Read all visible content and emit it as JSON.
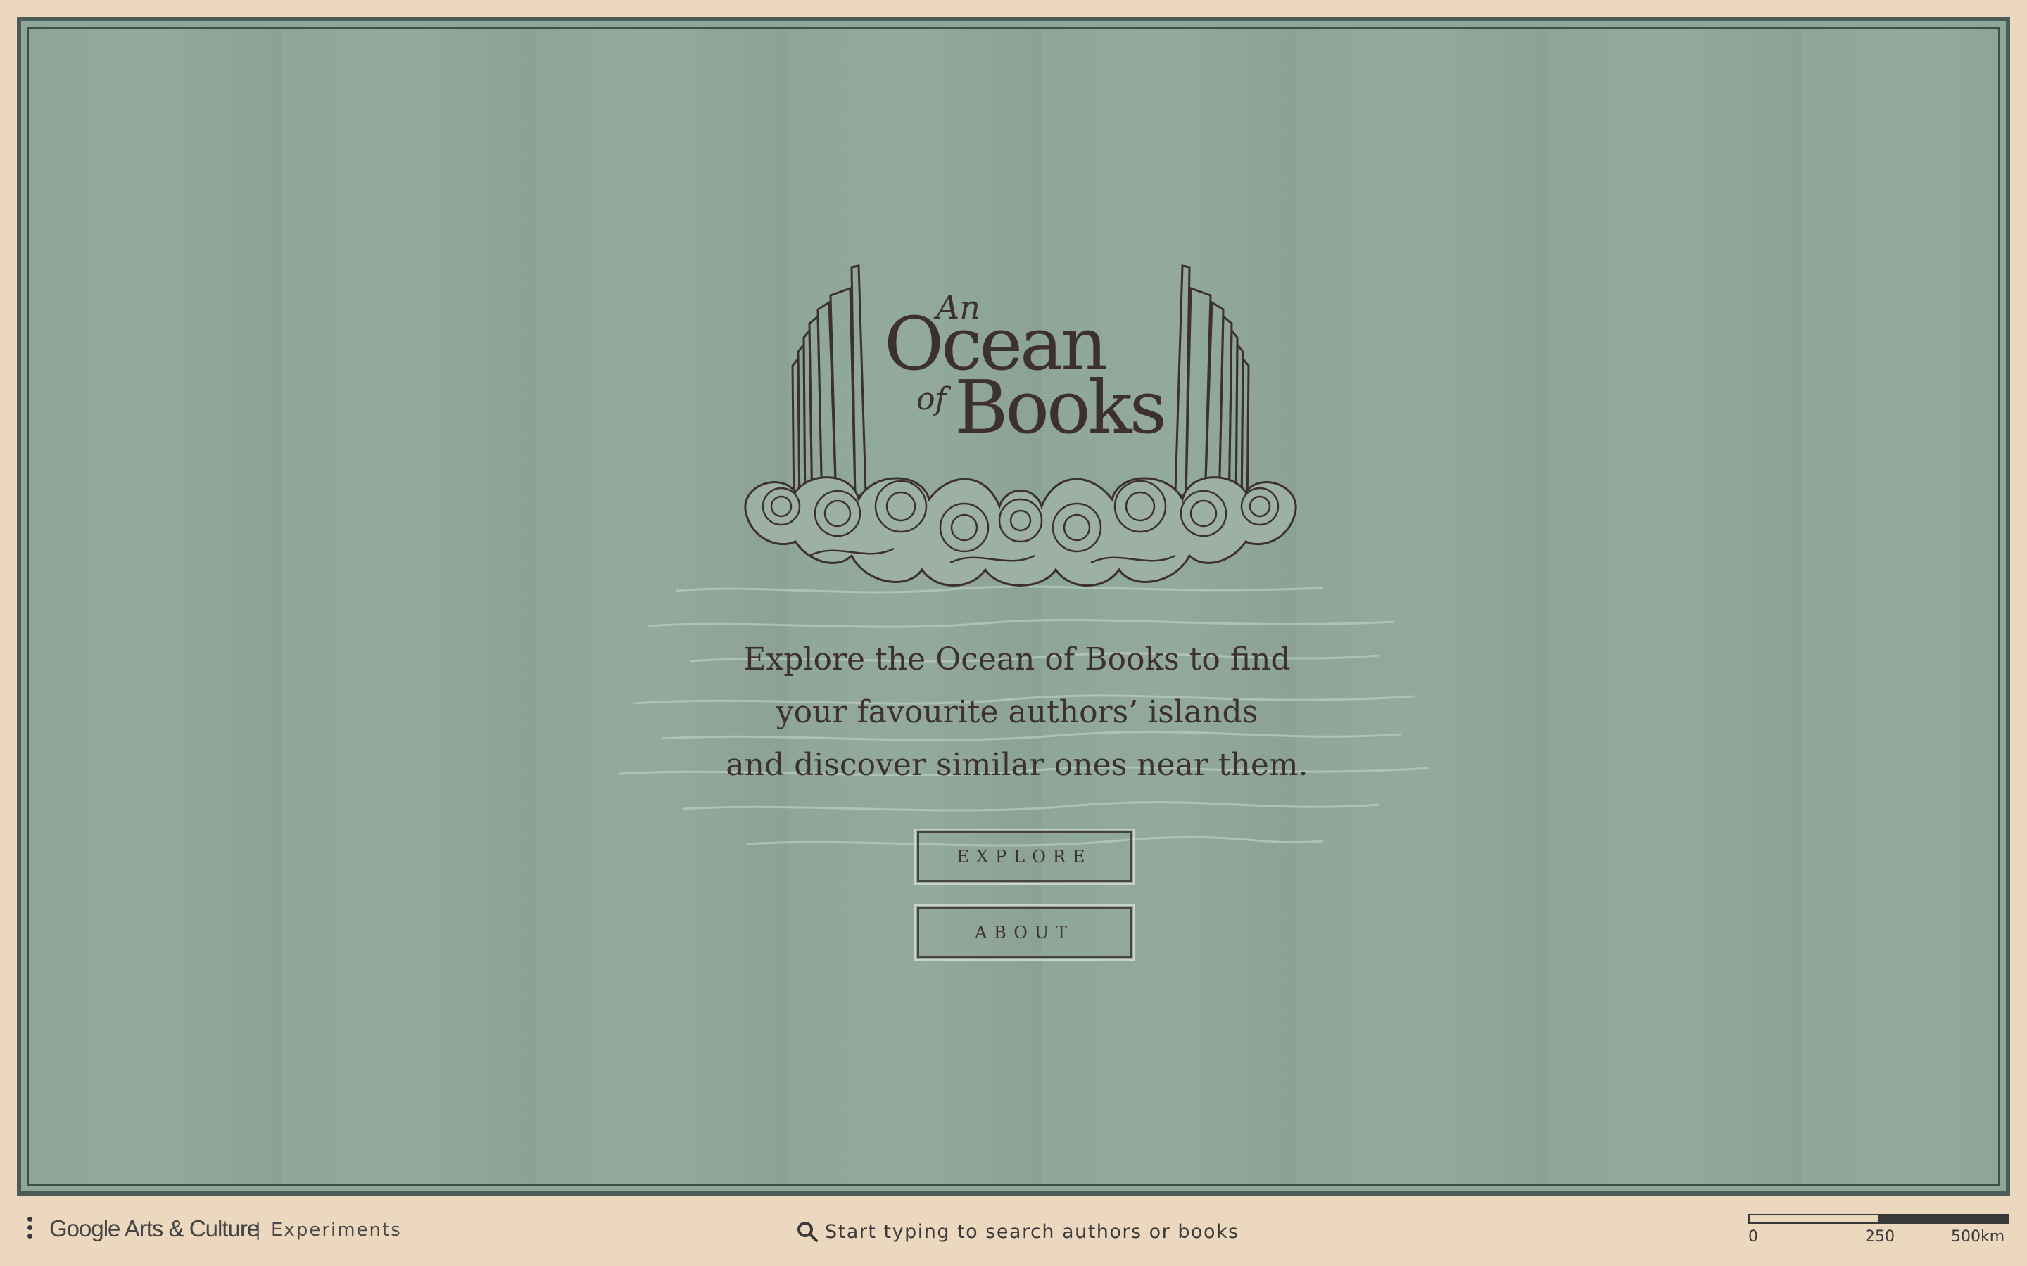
{
  "logo": {
    "title_an": "An",
    "title_ocean": "Ocean",
    "title_of": "of",
    "title_books": "Books"
  },
  "tagline": {
    "line1": "Explore the Ocean of Books to find",
    "line2": "your favourite authors’ islands",
    "line3": "and discover similar ones near them."
  },
  "buttons": {
    "explore": "EXPLORE",
    "about": "ABOUT"
  },
  "footer": {
    "brand": "Google Arts & Culture",
    "separator": "|",
    "experiments": "Experiments",
    "search_placeholder": "Start typing to search authors or books",
    "scale": {
      "label_0": "0",
      "label_1": "250",
      "label_2": "500km"
    }
  },
  "colors": {
    "sea": "#8fa799",
    "frame": "#4b5b55",
    "paper": "#ecd8bf",
    "ink": "#3d3033"
  }
}
